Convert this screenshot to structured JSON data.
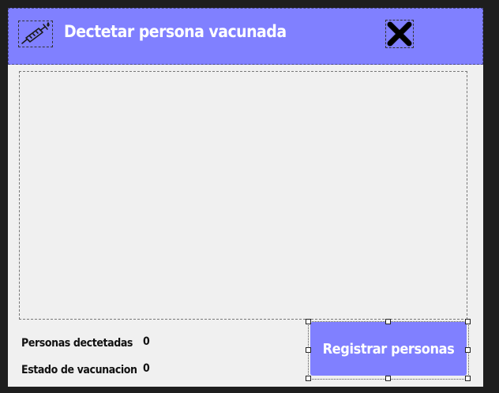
{
  "window": {
    "title": "Dectetar persona vacunada",
    "accent_color": "#8080ff",
    "app_icon": "syringe-icon",
    "close_icon": "close-x-icon"
  },
  "stats": {
    "detected_label": "Personas dectetadas",
    "detected_value": "0",
    "status_label": "Estado de vacunacion",
    "status_value": "0"
  },
  "actions": {
    "register_label": "Registrar personas"
  }
}
